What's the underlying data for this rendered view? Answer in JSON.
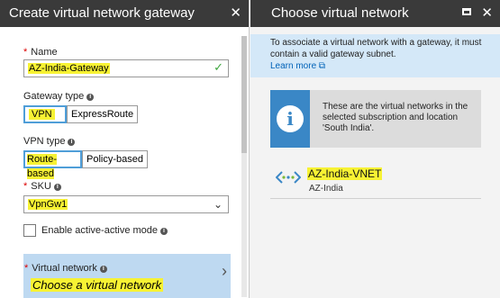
{
  "left_blade": {
    "title": "Create virtual network gateway",
    "name": {
      "label": "Name",
      "value": "AZ-India-Gateway"
    },
    "gateway_type": {
      "label": "Gateway type",
      "options": [
        "VPN",
        "ExpressRoute"
      ],
      "selected": "VPN"
    },
    "vpn_type": {
      "label": "VPN type",
      "options": [
        "Route-based",
        "Policy-based"
      ],
      "selected": "Route-based"
    },
    "sku": {
      "label": "SKU",
      "value": "VpnGw1"
    },
    "active_active": {
      "label": "Enable active-active mode",
      "checked": false
    },
    "virtual_network": {
      "label": "Virtual network",
      "placeholder": "Choose a virtual network"
    }
  },
  "right_blade": {
    "title": "Choose virtual network",
    "notice": "To associate a virtual network with a gateway, it must contain a valid gateway subnet.",
    "learn_more": "Learn more",
    "info_text": "These are the virtual networks in the selected subscription and location 'South India'.",
    "vnets": [
      {
        "name": "AZ-India-VNET",
        "resource_group": "AZ-India"
      }
    ]
  },
  "colors": {
    "header": "#3a3a3a",
    "highlight": "#f7f233",
    "accent": "#4f9ed8",
    "info_blue": "#3a87c6"
  }
}
